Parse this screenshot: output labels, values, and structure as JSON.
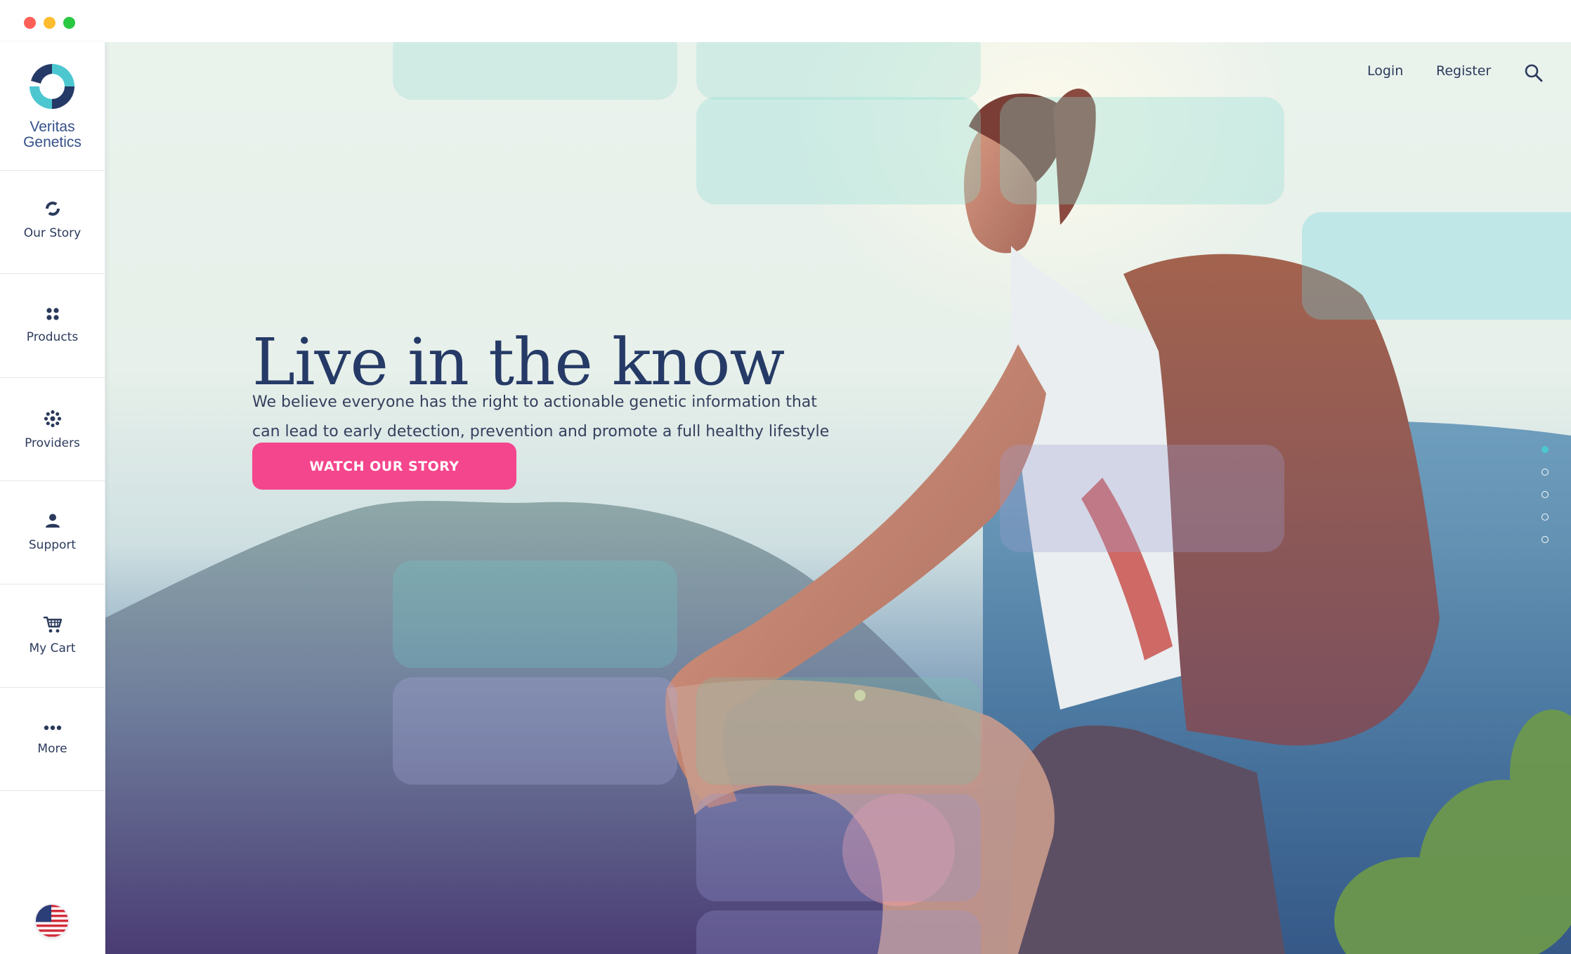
{
  "brand": {
    "name_line1": "Veritas",
    "name_line2": "Genetics",
    "colors": {
      "primary": "#253a66",
      "accent": "#4cc7d0",
      "cta": "#f4468d"
    }
  },
  "sidebar": {
    "items": [
      {
        "label": "Our Story",
        "icon": "logo-mark-icon"
      },
      {
        "label": "Products",
        "icon": "four-dots-icon"
      },
      {
        "label": "Providers",
        "icon": "dot-ring-icon"
      },
      {
        "label": "Support",
        "icon": "person-icon"
      },
      {
        "label": "My Cart",
        "icon": "cart-icon"
      },
      {
        "label": "More",
        "icon": "ellipsis-icon"
      }
    ],
    "locale_icon": "us-flag-icon"
  },
  "header": {
    "login": "Login",
    "register": "Register",
    "search_icon": "search-icon"
  },
  "hero": {
    "headline": "Live in the know",
    "subtext_line1": "We believe everyone has the right to actionable genetic information that",
    "subtext_line2": "can lead to early detection, prevention and promote a full healthy lifestyle",
    "cta_label": "WATCH OUR STORY",
    "slide_count": 5,
    "active_slide": 1
  }
}
